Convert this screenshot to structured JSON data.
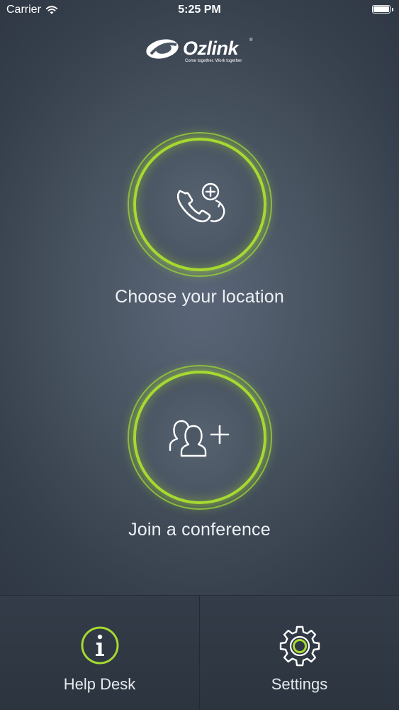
{
  "status_bar": {
    "carrier": "Carrier",
    "time": "5:25 PM",
    "wifi_icon": "wifi-icon",
    "battery_icon": "battery-full-icon"
  },
  "logo": {
    "name": "Ozlink",
    "registered_mark": "®",
    "tagline": "Come together. Work together"
  },
  "actions": [
    {
      "label": "Choose your location",
      "icon": "phone-add-icon"
    },
    {
      "label": "Join a conference",
      "icon": "add-group-icon"
    }
  ],
  "bottom_bar": {
    "help_desk": {
      "label": "Help Desk",
      "icon": "info-icon"
    },
    "settings": {
      "label": "Settings",
      "icon": "gear-icon"
    }
  },
  "colors": {
    "accent": "#a6d931",
    "background": "#3d4755",
    "text": "#ffffff"
  }
}
